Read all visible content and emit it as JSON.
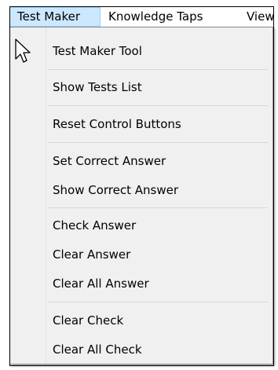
{
  "menubar": {
    "items": [
      {
        "label": "Test Maker"
      },
      {
        "label": "Knowledge Taps"
      },
      {
        "label": "View"
      }
    ]
  },
  "menu": {
    "items": [
      {
        "label": "Test Maker Tool"
      },
      {
        "label": "Show Tests List"
      },
      {
        "label": "Reset Control Buttons"
      },
      {
        "label": "Set Correct Answer"
      },
      {
        "label": "Show Correct Answer"
      },
      {
        "label": "Check Answer"
      },
      {
        "label": "Clear Answer"
      },
      {
        "label": "Clear All Answer"
      },
      {
        "label": "Clear Check"
      },
      {
        "label": "Clear All Check"
      }
    ]
  },
  "colors": {
    "highlight": "#cce8ff",
    "highlight_border": "#99d1ff",
    "menu_background": "#f0f0f0"
  },
  "cursor": {
    "icon": "arrow-cursor-icon"
  }
}
